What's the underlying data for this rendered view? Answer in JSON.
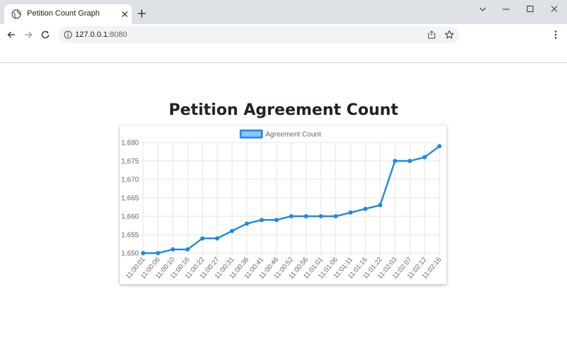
{
  "browser": {
    "tab_title": "Petition Count Graph",
    "url_host": "127.0.0.1",
    "url_port": ":8080",
    "icons": {
      "favicon": "globe-icon",
      "close": "close-icon",
      "new_tab": "plus-icon",
      "back": "arrow-left-icon",
      "forward": "arrow-right-icon",
      "reload": "reload-icon",
      "info": "info-icon",
      "share": "share-icon",
      "bookmark": "star-icon",
      "menu": "kebab-menu-icon"
    }
  },
  "page": {
    "title": "Petition Agreement Count"
  },
  "chart_data": {
    "type": "line",
    "title": "",
    "xlabel": "",
    "ylabel": "",
    "legend_position": "top",
    "grid": true,
    "ylim": [
      1650,
      1680
    ],
    "yticks": [
      1650,
      1655,
      1660,
      1665,
      1670,
      1675,
      1680
    ],
    "ytick_labels": [
      "1,650",
      "1,655",
      "1,660",
      "1,665",
      "1,670",
      "1,675",
      "1,680"
    ],
    "categories": [
      "11:00:01",
      "11:00:06",
      "11:00:10",
      "11:00:16",
      "11:00:22",
      "11:00:27",
      "11:00:31",
      "11:00:36",
      "11:00:41",
      "11:00:46",
      "11:00:52",
      "11:00:56",
      "11:01:01",
      "11:01:06",
      "11:01:11",
      "11:01:16",
      "11:01:22",
      "11:02:03",
      "11:02:07",
      "11:02:12",
      "11:02:16"
    ],
    "series": [
      {
        "name": "Agreement Count",
        "color": "#1e88e5",
        "fill": "#90c2f9",
        "values": [
          1650,
          1650,
          1651,
          1651,
          1654,
          1654,
          1656,
          1658,
          1659,
          1659,
          1660,
          1660,
          1660,
          1660,
          1661,
          1662,
          1663,
          1675,
          1675,
          1676,
          1679
        ]
      }
    ]
  }
}
